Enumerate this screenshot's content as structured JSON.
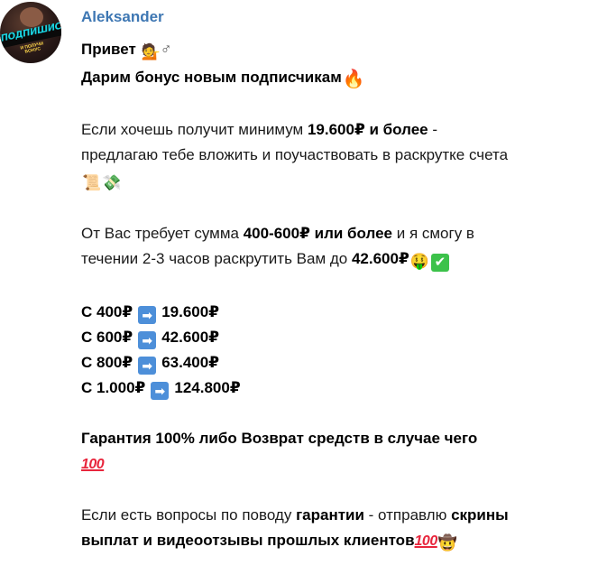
{
  "sender": {
    "name": "Aleksander",
    "avatar_text": "ПОДПИШИСЬ",
    "avatar_subtext": "И ПОЛУЧИ БОНУС"
  },
  "message": {
    "greeting": "Привет",
    "bonus_line": "Дарим бонус новым подписчикам",
    "p1_a": "Если хочешь получит минимум ",
    "p1_b": "19.600₽ и более",
    "p1_c": " -",
    "p1_line2": "предлагаю тебе вложить и поучаствовать в раскрутке счета",
    "p2_a": "От Вас требует сумма ",
    "p2_b": "400-600₽ или более",
    "p2_c": " и я смогу в",
    "p2_line2_a": "течении 2-3 часов раскрутить Вам до ",
    "p2_line2_b": "42.600₽",
    "rates": [
      {
        "from": "С 400₽",
        "to": "19.600₽"
      },
      {
        "from": "С 600₽",
        "to": "42.600₽"
      },
      {
        "from": "С 800₽",
        "to": "63.400₽"
      },
      {
        "from": "С 1.000₽",
        "to": "124.800₽"
      }
    ],
    "guarantee": "Гарантия 100% либо Возврат средств в случае чего",
    "p3_a": "Если есть вопросы по поводу ",
    "p3_b": "гарантии",
    "p3_c": " - отправлю ",
    "p3_d": "скрины",
    "p3_line2": "выплат и видеоотзывы прошлых клиентов",
    "hundred_label": "100"
  },
  "icons": {
    "arrow": "➡",
    "check": "✔",
    "fire": "🔥",
    "money_face": "🤑",
    "woman": "💁",
    "venus": "♂",
    "scroll": "📜",
    "money_wings": "💸",
    "cowboy": "🤠"
  },
  "colors": {
    "sender": "#3e77b3",
    "arrow_box": "#4d8fd9",
    "check_box": "#3cc24a",
    "hundred": "#e8253c"
  }
}
